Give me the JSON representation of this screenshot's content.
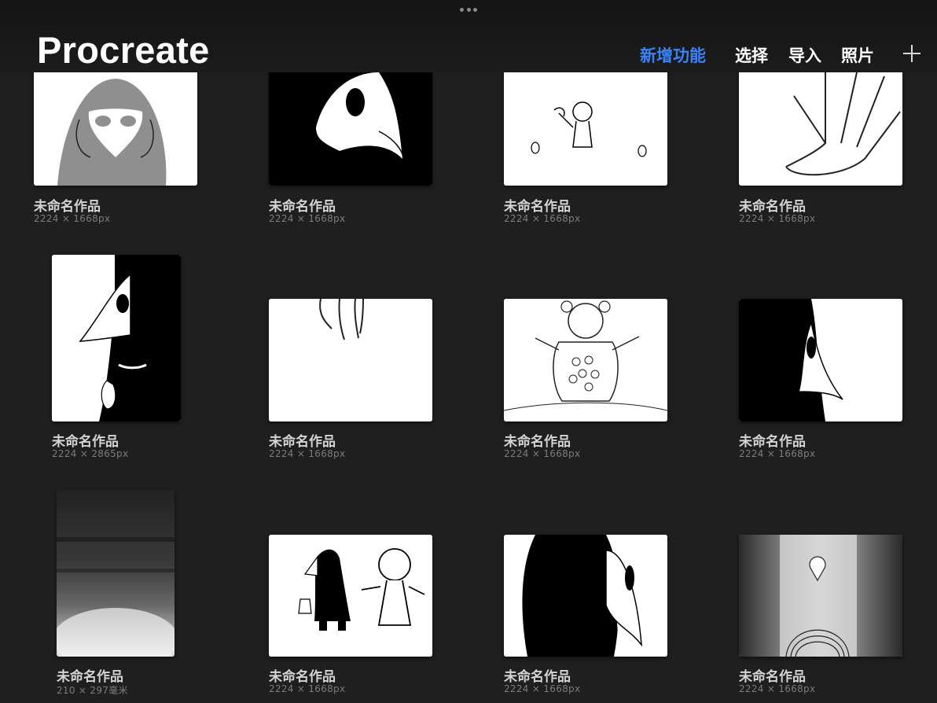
{
  "header": {
    "title": "Procreate",
    "nav": {
      "whats_new": "新增功能",
      "select": "选择",
      "import": "导入",
      "photo": "照片"
    },
    "accent_color": "#3a82f7"
  },
  "artworks": [
    {
      "name": "未命名作品",
      "size": "2224 × 1668px",
      "thumb": "hooded-figure"
    },
    {
      "name": "未命名作品",
      "size": "2224 × 1668px",
      "thumb": "plague-mask-large"
    },
    {
      "name": "未命名作品",
      "size": "2224 × 1668px",
      "thumb": "small-figure-sketch"
    },
    {
      "name": "未命名作品",
      "size": "2224 × 1668px",
      "thumb": "hand-outline"
    },
    {
      "name": "未命名作品",
      "size": "2224 × 2865px",
      "thumb": "plague-doctor-portrait"
    },
    {
      "name": "未命名作品",
      "size": "2224 × 1668px",
      "thumb": "hand-top"
    },
    {
      "name": "未命名作品",
      "size": "2224 × 1668px",
      "thumb": "bear-monster"
    },
    {
      "name": "未命名作品",
      "size": "2224 × 1668px",
      "thumb": "mask-profile-dark"
    },
    {
      "name": "未命名作品",
      "size": "210 × 297毫米",
      "thumb": "dark-texture"
    },
    {
      "name": "未命名作品",
      "size": "2224 × 1668px",
      "thumb": "two-characters"
    },
    {
      "name": "未命名作品",
      "size": "2224 × 1668px",
      "thumb": "mask-closeup"
    },
    {
      "name": "未命名作品",
      "size": "2224 × 1668px",
      "thumb": "doorway-mask"
    }
  ]
}
